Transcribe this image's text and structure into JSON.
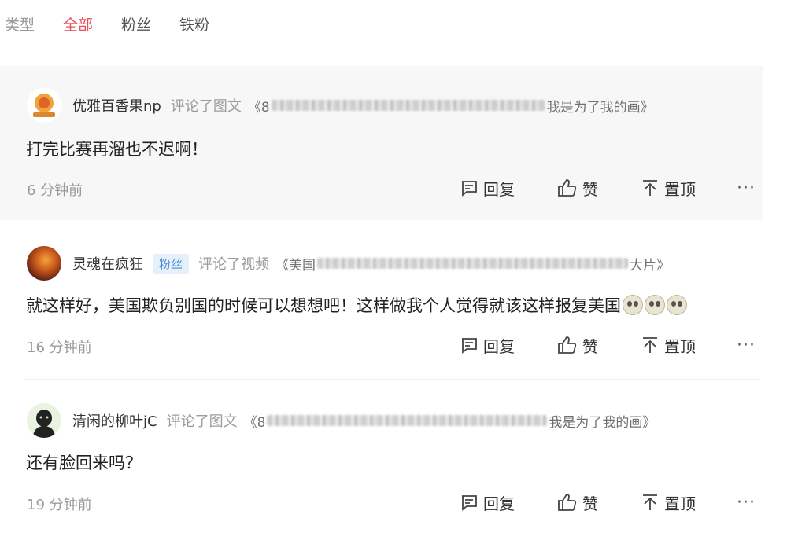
{
  "filters": {
    "label": "类型",
    "options": [
      {
        "label": "全部",
        "active": true
      },
      {
        "label": "粉丝",
        "active": false
      },
      {
        "label": "铁粉",
        "active": false
      }
    ]
  },
  "actions": {
    "reply": "回复",
    "like": "赞",
    "pin": "置顶",
    "more": "···"
  },
  "comments": [
    {
      "username": "优雅百香果np",
      "badge": "",
      "action": "评论了图文",
      "ref_start": "《8",
      "ref_end": "我是为了我的画》",
      "text": "打完比赛再溜也不迟啊！",
      "time": "6 分钟前",
      "highlighted": true
    },
    {
      "username": "灵魂在疯狂",
      "badge": "粉丝",
      "action": "评论了视频",
      "ref_start": "《美国",
      "ref_end": "大片》",
      "text": "就这样好，美国欺负别国的时候可以想想吧！这样做我个人觉得就该这样报复美国",
      "emoji_count": 3,
      "time": "16 分钟前",
      "highlighted": false
    },
    {
      "username": "清闲的柳叶jC",
      "badge": "",
      "action": "评论了图文",
      "ref_start": "《8",
      "ref_end": "我是为了我的画》",
      "text": "还有脸回来吗？",
      "time": "19 分钟前",
      "highlighted": false
    }
  ],
  "colors": {
    "accent_active": "#e8525a",
    "fan_badge": "#4a8ad6",
    "highlight_bg": "#f7f7f7"
  }
}
